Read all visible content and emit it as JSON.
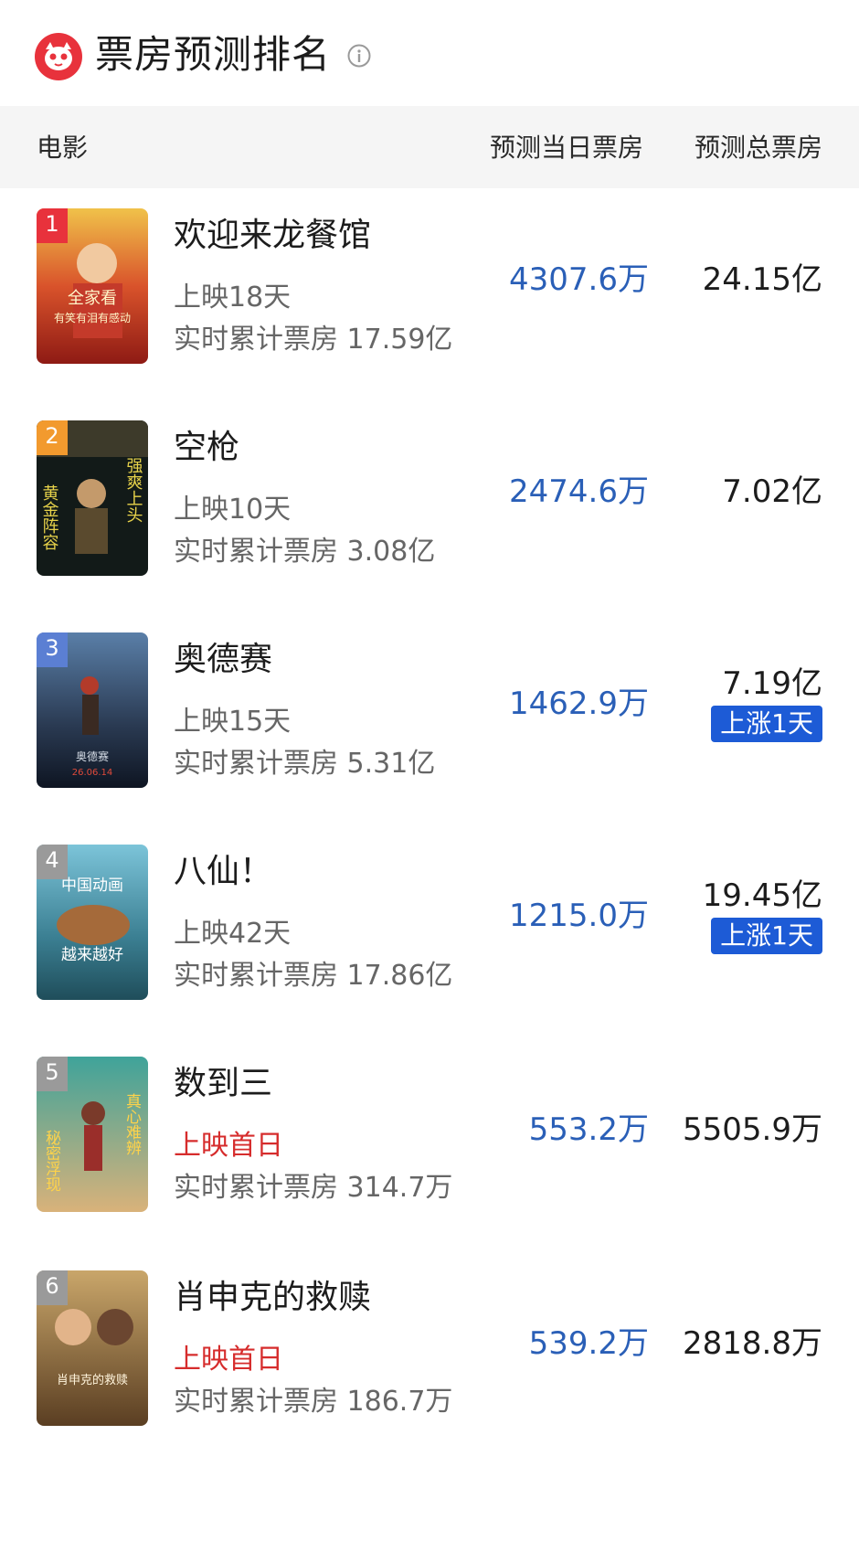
{
  "header": {
    "title": "票房预测排名",
    "logo_icon": "maoyan-cat-logo",
    "info_icon": "info-icon"
  },
  "table": {
    "col_movie": "电影",
    "col_day": "预测当日票房",
    "col_total": "预测总票房"
  },
  "colors": {
    "accent_blue": "#2a5fb7",
    "tag_blue": "#1d5bd6",
    "first_day_red": "#d62c2c",
    "rank1": "#e8323c",
    "rank2": "#f29a2e",
    "rank3": "#5b7fd3",
    "rank_other": "#9a9a9a"
  },
  "movies": [
    {
      "rank": "1",
      "title": "欢迎来龙餐馆",
      "days": "上映18天",
      "cumulative": "实时累计票房 17.59亿",
      "day_pred": "4307.6万",
      "total_pred": "24.15亿",
      "tag": "",
      "poster_text": [
        "全家看",
        "有笑有泪有感动"
      ]
    },
    {
      "rank": "2",
      "title": "空枪",
      "days": "上映10天",
      "cumulative": "实时累计票房 3.08亿",
      "day_pred": "2474.6万",
      "total_pred": "7.02亿",
      "tag": "",
      "poster_text": [
        "黄金阵容",
        "强爽上头"
      ]
    },
    {
      "rank": "3",
      "title": "奥德赛",
      "days": "上映15天",
      "cumulative": "实时累计票房 5.31亿",
      "day_pred": "1462.9万",
      "total_pred": "7.19亿",
      "tag": "上涨1天",
      "poster_text": [
        "奥德赛",
        "26.06.14"
      ]
    },
    {
      "rank": "4",
      "title": "八仙！",
      "days": "上映42天",
      "cumulative": "实时累计票房 17.86亿",
      "day_pred": "1215.0万",
      "total_pred": "19.45亿",
      "tag": "上涨1天",
      "poster_text": [
        "中国动画",
        "越来越好"
      ]
    },
    {
      "rank": "5",
      "title": "数到三",
      "days": "上映首日",
      "cumulative": "实时累计票房 314.7万",
      "day_pred": "553.2万",
      "total_pred": "5505.9万",
      "tag": "",
      "poster_text": [
        "秘密浮现",
        "真心难辨"
      ]
    },
    {
      "rank": "6",
      "title": "肖申克的救赎",
      "days": "上映首日",
      "cumulative": "实时累计票房 186.7万",
      "day_pred": "539.2万",
      "total_pred": "2818.8万",
      "tag": "",
      "poster_text": [
        "肖申克的救赎"
      ]
    }
  ]
}
